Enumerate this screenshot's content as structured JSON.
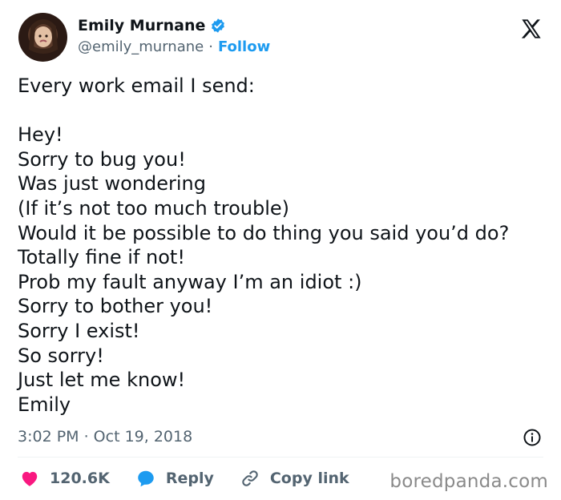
{
  "author": {
    "name": "Emily Murnane",
    "handle": "@emily_murnane",
    "separator": "·",
    "follow_label": "Follow"
  },
  "tweet": {
    "lines": [
      "Every work email I send:",
      "",
      "Hey!",
      "Sorry to bug you!",
      "Was just wondering",
      "(If it’s not too much trouble)",
      "Would it be possible to do thing you said you’d do?",
      "Totally fine if not!",
      "Prob my fault anyway I’m an idiot :)",
      "Sorry to bother you!",
      "Sorry I exist!",
      "So sorry!",
      "Just let me know!",
      "Emily"
    ],
    "timestamp": "3:02 PM · Oct 19, 2018"
  },
  "actions": {
    "likes": "120.6K",
    "reply_label": "Reply",
    "copy_label": "Copy link"
  },
  "watermark": "boredpanda.com",
  "colors": {
    "brand_blue": "#1d9bf0",
    "like_pink": "#f91880",
    "muted": "#536471"
  },
  "icons": [
    "verified-icon",
    "x-logo-icon",
    "info-icon",
    "heart-icon",
    "reply-bubble-icon",
    "link-icon"
  ]
}
